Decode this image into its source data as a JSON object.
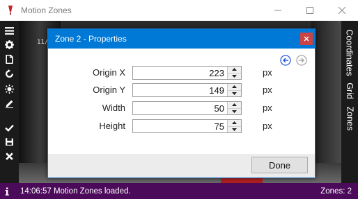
{
  "window": {
    "title": "Motion Zones",
    "controls": [
      "minimize",
      "maximize",
      "close"
    ]
  },
  "toolbar": {
    "items": [
      {
        "icon": "menu-icon"
      },
      {
        "icon": "gear-icon"
      },
      {
        "icon": "document-icon"
      },
      {
        "icon": "refresh-icon"
      },
      {
        "icon": "brightness-icon"
      },
      {
        "icon": "pencil-icon"
      },
      {
        "icon": "check-icon"
      },
      {
        "icon": "save-icon"
      },
      {
        "icon": "close-icon"
      }
    ]
  },
  "video": {
    "osd_text": "11/"
  },
  "side_tabs": [
    "Coordinates",
    "Grid",
    "Zones"
  ],
  "dialog": {
    "title": "Zone 2 - Properties",
    "fields": [
      {
        "label": "Origin X",
        "value": "223",
        "unit": "px"
      },
      {
        "label": "Origin Y",
        "value": "149",
        "unit": "px"
      },
      {
        "label": "Width",
        "value": "50",
        "unit": "px"
      },
      {
        "label": "Height",
        "value": "75",
        "unit": "px"
      }
    ],
    "done_label": "Done"
  },
  "status": {
    "message": "14:06:57 Motion Zones loaded.",
    "zones_count": "Zones: 2"
  },
  "colors": {
    "accent": "#0079d6",
    "status_bar": "#4b0a5a",
    "close_button": "#c94545",
    "app_icon": "#c0262d"
  }
}
